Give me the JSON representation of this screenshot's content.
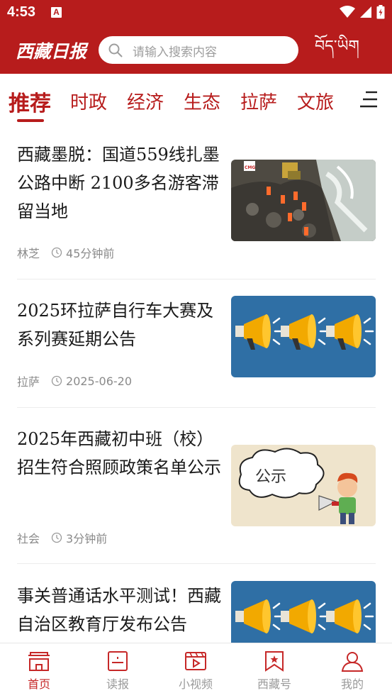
{
  "status_bar": {
    "time": "4:53",
    "badge": "A",
    "icons": [
      "wifi-icon",
      "signal-icon",
      "battery-icon"
    ]
  },
  "header": {
    "logo_text": "西藏日报",
    "search_placeholder": "请输入搜索内容",
    "tibetan_text": "བོད་ཡིག",
    "brand_color": "#b71c1c"
  },
  "tabs": [
    {
      "label": "推荐",
      "active": true
    },
    {
      "label": "时政"
    },
    {
      "label": "经济"
    },
    {
      "label": "生态"
    },
    {
      "label": "拉萨"
    },
    {
      "label": "文旅"
    }
  ],
  "articles": [
    {
      "title": "西藏墨脱：国道559线扎墨公路中断 2100多名游客滞留当地",
      "source": "林芝",
      "time": "45分钟前",
      "thumb_badge": "CMG",
      "thumb": "landslide-photo"
    },
    {
      "title": "2025环拉萨自行车大赛及系列赛延期公告",
      "source": "拉萨",
      "time": "2025-06-20",
      "thumb": "megaphones-illustration"
    },
    {
      "title": "2025年西藏初中班（校）招生符合照顾政策名单公示",
      "source": "社会",
      "time": "3分钟前",
      "thumb_caption": "公示",
      "thumb": "announcement-illustration"
    },
    {
      "title": "事关普通话水平测试！西藏自治区教育厅发布公告",
      "thumb": "megaphones-illustration"
    }
  ],
  "bottom_nav": [
    {
      "label": "首页",
      "icon": "home-icon",
      "active": true
    },
    {
      "label": "读报",
      "icon": "newspaper-icon"
    },
    {
      "label": "小视频",
      "icon": "video-icon"
    },
    {
      "label": "西藏号",
      "icon": "bookmark-icon"
    },
    {
      "label": "我的",
      "icon": "user-icon"
    }
  ]
}
